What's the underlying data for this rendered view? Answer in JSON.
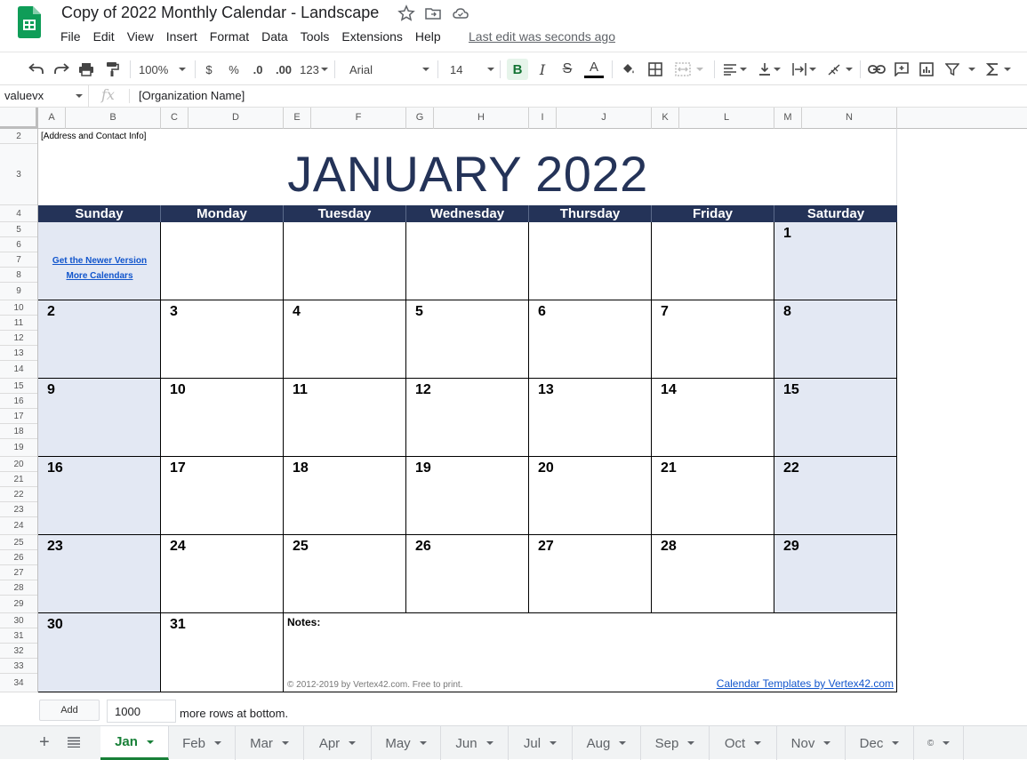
{
  "app": {
    "title": "Copy of 2022 Monthly Calendar - Landscape",
    "logo_icon": "google-sheets-logo",
    "brand_color": "#0f9d58",
    "last_edit": "Last edit was seconds ago",
    "title_icons": [
      "star-icon",
      "move-folder-icon",
      "cloud-status-icon"
    ]
  },
  "menu": [
    "File",
    "Edit",
    "View",
    "Insert",
    "Format",
    "Data",
    "Tools",
    "Extensions",
    "Help"
  ],
  "toolbar": {
    "zoom": "100%",
    "currency": "$",
    "percent": "%",
    "decrease_decimal": ".0",
    "increase_decimal": ".00",
    "more_formats": "123",
    "font": "Arial",
    "font_size": "14",
    "bold": "B",
    "italic": "I",
    "strikethrough": "S",
    "text_color": "A",
    "text_color_value": "#000000"
  },
  "formula_bar": {
    "name_box": "valuevx",
    "fx": "fx",
    "content": "[Organization Name]"
  },
  "columns": [
    "A",
    "B",
    "C",
    "D",
    "E",
    "F",
    "G",
    "H",
    "I",
    "J",
    "K",
    "L",
    "M",
    "N"
  ],
  "rows": [
    "2",
    "3",
    "4",
    "5",
    "6",
    "7",
    "8",
    "9",
    "10",
    "11",
    "12",
    "13",
    "14",
    "15",
    "16",
    "17",
    "18",
    "19",
    "20",
    "21",
    "22",
    "23",
    "24",
    "25",
    "26",
    "27",
    "28",
    "29",
    "30",
    "31",
    "32",
    "33",
    "34"
  ],
  "calendar": {
    "address_info": "[Address and Contact Info]",
    "month_title": "JANUARY 2022",
    "header_color": "#243358",
    "weekend_color": "#e3e8f3",
    "day_names": [
      "Sunday",
      "Monday",
      "Tuesday",
      "Wednesday",
      "Thursday",
      "Friday",
      "Saturday"
    ],
    "weeks": [
      [
        "",
        "",
        "",
        "",
        "",
        "",
        "1"
      ],
      [
        "2",
        "3",
        "4",
        "5",
        "6",
        "7",
        "8"
      ],
      [
        "9",
        "10",
        "11",
        "12",
        "13",
        "14",
        "15"
      ],
      [
        "16",
        "17",
        "18",
        "19",
        "20",
        "21",
        "22"
      ],
      [
        "23",
        "24",
        "25",
        "26",
        "27",
        "28",
        "29"
      ],
      [
        "30",
        "31"
      ]
    ],
    "promo_links": [
      "Get the Newer Version",
      "More Calendars"
    ],
    "notes_label": "Notes:",
    "copyright": "© 2012-2019 by Vertex42.com. Free to print.",
    "templates_link": "Calendar Templates by Vertex42.com"
  },
  "add_rows": {
    "button": "Add",
    "count": "1000",
    "suffix": "more rows at bottom."
  },
  "sheet_tabs": [
    "Jan",
    "Feb",
    "Mar",
    "Apr",
    "May",
    "Jun",
    "Jul",
    "Aug",
    "Sep",
    "Oct",
    "Nov",
    "Dec",
    "©"
  ],
  "active_tab": "Jan"
}
